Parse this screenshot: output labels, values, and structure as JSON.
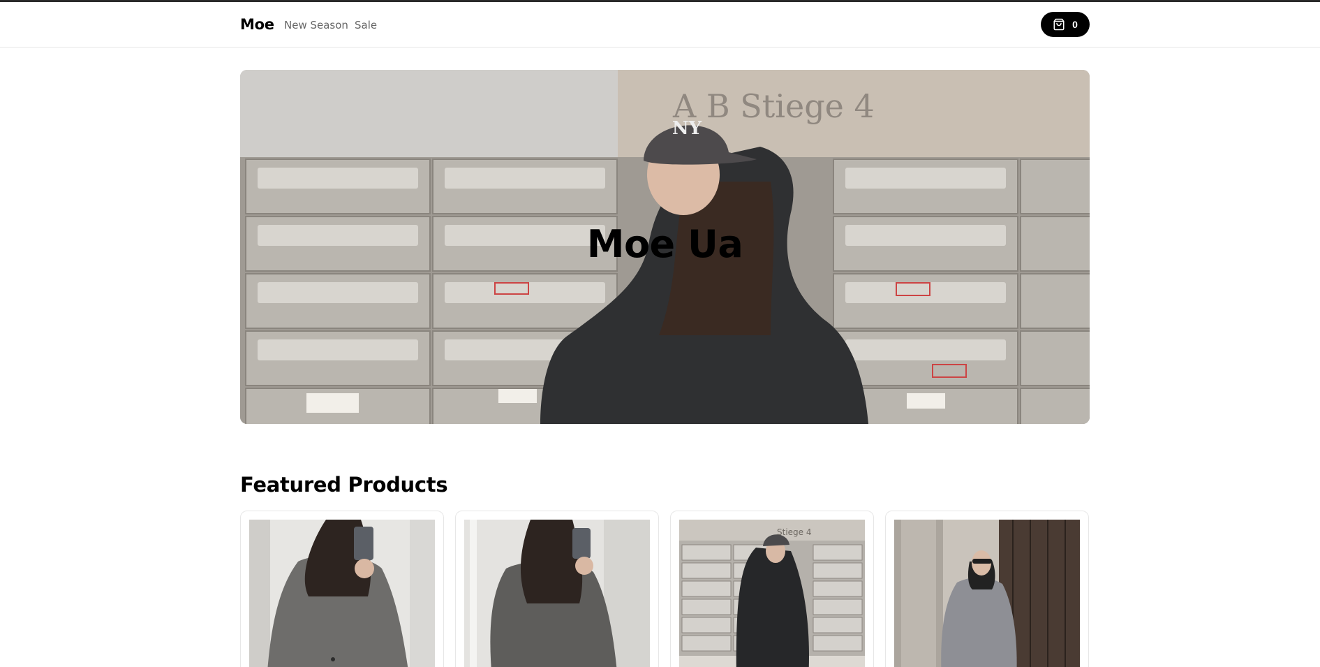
{
  "header": {
    "logo": "Moe",
    "nav": [
      {
        "label": "New Season"
      },
      {
        "label": "Sale"
      }
    ],
    "cart": {
      "count": "0",
      "icon": "shopping-bag-icon"
    }
  },
  "hero": {
    "title": "Moe Ua",
    "wall_text": "A B   Stiege 4"
  },
  "featured": {
    "title": "Featured Products",
    "products": [
      {
        "image": "woman-grey-coat-mirror-selfie"
      },
      {
        "image": "woman-grey-coat-mirror-selfie-side"
      },
      {
        "image": "woman-black-blazer-mailboxes"
      },
      {
        "image": "woman-grey-coat-doorway"
      }
    ]
  },
  "colors": {
    "accent": "#000000",
    "muted_text": "#666666",
    "border": "#e7e7e7"
  }
}
